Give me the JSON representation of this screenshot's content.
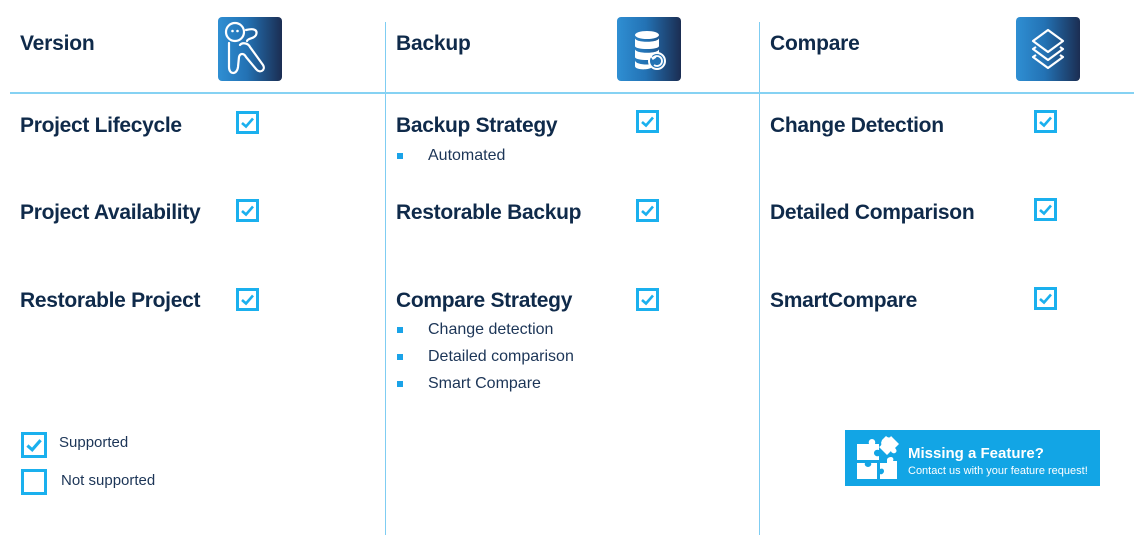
{
  "columns": [
    {
      "title": "Version",
      "icon": "octopus-icon",
      "features": [
        {
          "label": "Project Lifecycle",
          "supported": true,
          "details": []
        },
        {
          "label": "Project Availability",
          "supported": true,
          "details": []
        },
        {
          "label": "Restorable Project",
          "supported": true,
          "details": []
        }
      ]
    },
    {
      "title": "Backup",
      "icon": "database-restore-icon",
      "features": [
        {
          "label": "Backup Strategy",
          "supported": true,
          "details": [
            "Automated"
          ]
        },
        {
          "label": "Restorable Backup",
          "supported": true,
          "details": []
        },
        {
          "label": "Compare Strategy",
          "supported": true,
          "details": [
            "Change detection",
            "Detailed comparison",
            "Smart Compare"
          ]
        }
      ]
    },
    {
      "title": "Compare",
      "icon": "layers-icon",
      "features": [
        {
          "label": "Change Detection",
          "supported": true,
          "details": []
        },
        {
          "label": "Detailed Comparison",
          "supported": true,
          "details": []
        },
        {
          "label": "SmartCompare",
          "supported": true,
          "details": []
        }
      ]
    }
  ],
  "legend": {
    "supported": "Supported",
    "not_supported": "Not supported"
  },
  "banner": {
    "title": "Missing a Feature?",
    "subtitle": "Contact us with your feature request!",
    "icon": "puzzle-icon"
  },
  "colors": {
    "accent": "#1ab0ee",
    "text": "#0f2a4a",
    "banner_bg": "#12a5e5",
    "divider": "#7fcdf2"
  }
}
